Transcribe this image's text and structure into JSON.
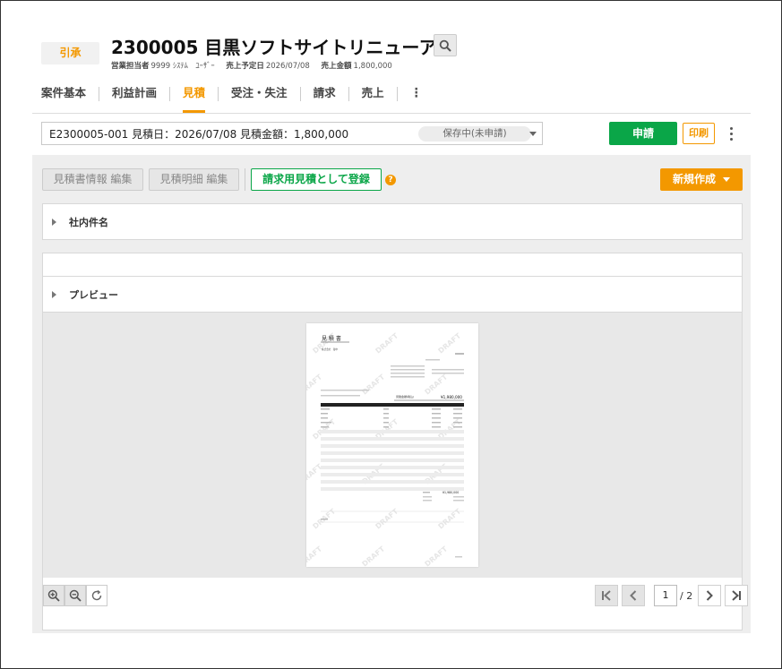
{
  "header": {
    "badge": "引承",
    "title": "2300005 目黒ソフトサイトリニューアル",
    "meta": [
      {
        "label": "営業担当者",
        "value": "9999 ｼｽﾃﾑ　ﾕｰｻﾞｰ"
      },
      {
        "label": "売上予定日",
        "value": "2026/07/08"
      },
      {
        "label": "売上金額",
        "value": "1,800,000"
      }
    ]
  },
  "tabs": [
    {
      "label": "案件基本"
    },
    {
      "label": "利益計画"
    },
    {
      "label": "見積"
    },
    {
      "label": "受注・失注"
    },
    {
      "label": "請求"
    },
    {
      "label": "売上"
    }
  ],
  "estimate": {
    "selected": "E2300005-001 見積日：2026/07/08 見積金額：1,800,000",
    "status": "保存中(未申請)"
  },
  "actions": {
    "apply": "申請",
    "print": "印刷"
  },
  "toolbar": {
    "edit_info": "見積書情報 編集",
    "edit_detail": "見積明細 編集",
    "register": "請求用見積として登録",
    "new": "新規作成"
  },
  "sections": {
    "internal_name": "社内件名",
    "preview": "プレビュー"
  },
  "document": {
    "heading": "見 積 書",
    "client": "株式会社　御中",
    "watermark": "DRAFT",
    "amount_label": "見積金額(税込)",
    "amount": "¥1,980,000",
    "total": "¥1,980,000"
  },
  "pager": {
    "current": "1",
    "total": "/ 2"
  },
  "colors": {
    "accent": "#f39800",
    "green": "#0aa648"
  }
}
